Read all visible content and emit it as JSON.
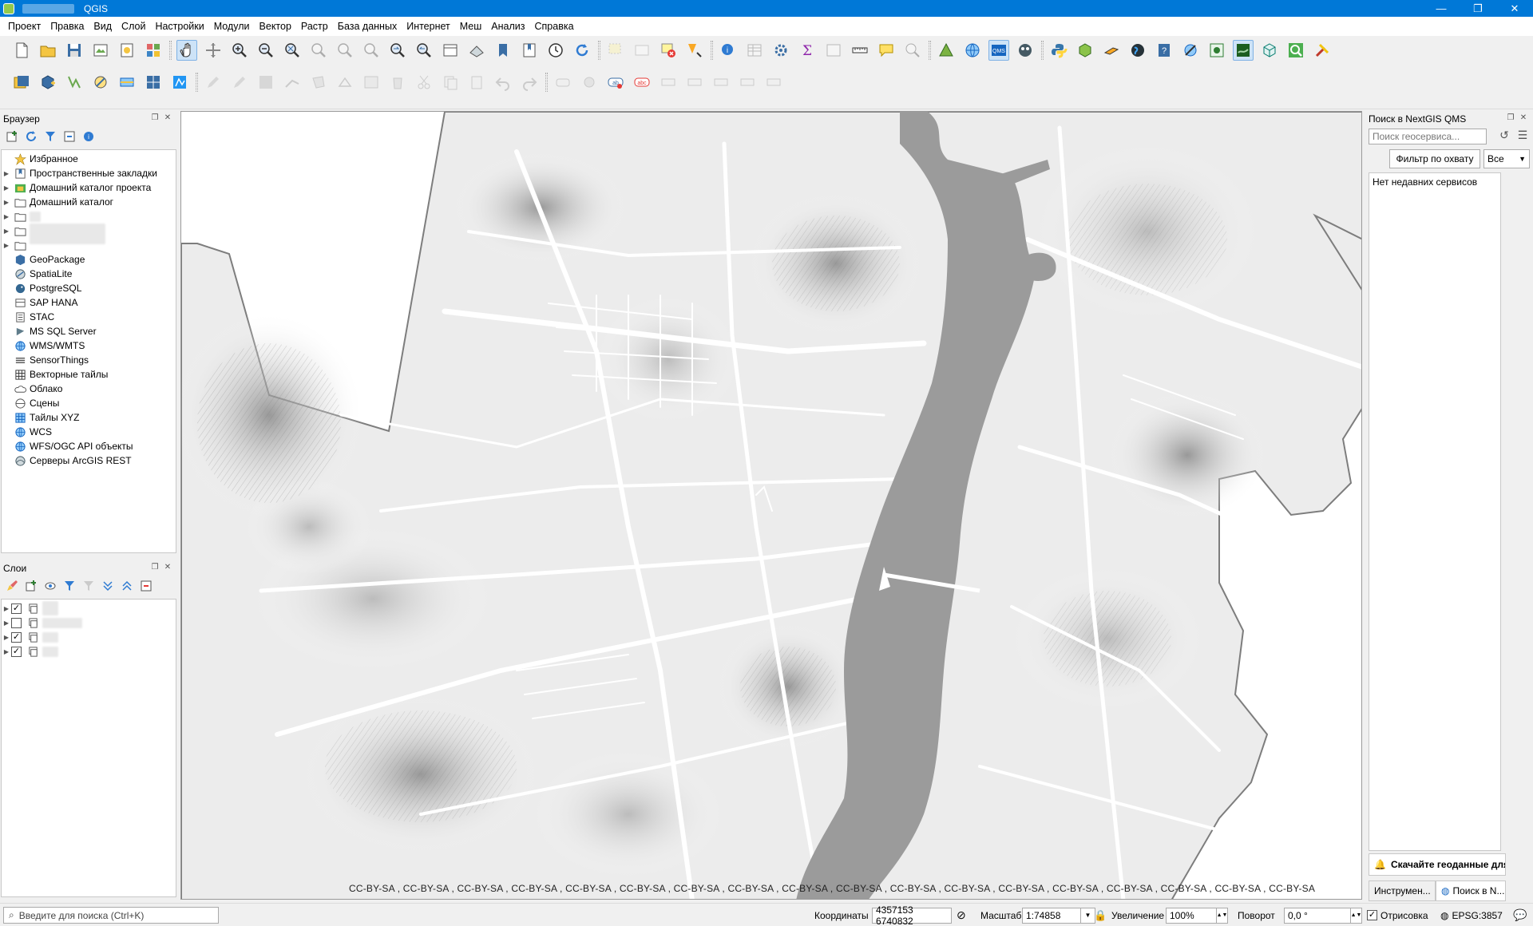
{
  "window": {
    "title": "QGIS",
    "controls": [
      "—",
      "❐",
      "✕"
    ]
  },
  "menu": [
    "Проект",
    "Правка",
    "Вид",
    "Слой",
    "Настройки",
    "Модули",
    "Вектор",
    "Растр",
    "База данных",
    "Интернет",
    "Меш",
    "Анализ",
    "Справка"
  ],
  "browser": {
    "title": "Браузер",
    "items": [
      {
        "label": "Избранное",
        "icon": "star-icon",
        "expand": false
      },
      {
        "label": "Пространственные закладки",
        "icon": "bookmark-icon",
        "expand": true
      },
      {
        "label": "Домашний каталог проекта",
        "icon": "project-home-icon",
        "expand": true
      },
      {
        "label": "Домашний каталог",
        "icon": "folder-icon",
        "expand": true
      },
      {
        "label": "",
        "icon": "folder-icon",
        "expand": true
      },
      {
        "label": "",
        "icon": "folder-icon",
        "expand": true
      },
      {
        "label": "",
        "icon": "folder-icon",
        "expand": true
      },
      {
        "label": "GeoPackage",
        "icon": "geopackage-icon",
        "expand": false
      },
      {
        "label": "SpatiaLite",
        "icon": "spatialite-icon",
        "expand": false
      },
      {
        "label": "PostgreSQL",
        "icon": "postgresql-icon",
        "expand": false
      },
      {
        "label": "SAP HANA",
        "icon": "sap-hana-icon",
        "expand": false
      },
      {
        "label": "STAC",
        "icon": "stac-icon",
        "expand": false
      },
      {
        "label": "MS SQL Server",
        "icon": "mssql-icon",
        "expand": false
      },
      {
        "label": "WMS/WMTS",
        "icon": "wms-icon",
        "expand": false
      },
      {
        "label": "SensorThings",
        "icon": "sensorthings-icon",
        "expand": false
      },
      {
        "label": "Векторные тайлы",
        "icon": "vector-tiles-icon",
        "expand": false
      },
      {
        "label": "Облако",
        "icon": "cloud-icon",
        "expand": false
      },
      {
        "label": "Сцены",
        "icon": "scenes-icon",
        "expand": false
      },
      {
        "label": "Тайлы XYZ",
        "icon": "xyz-tiles-icon",
        "expand": false
      },
      {
        "label": "WCS",
        "icon": "wcs-icon",
        "expand": false
      },
      {
        "label": "WFS/OGC API объекты",
        "icon": "wfs-icon",
        "expand": false
      },
      {
        "label": "Серверы ArcGIS REST",
        "icon": "arcgis-icon",
        "expand": false
      }
    ]
  },
  "layers": {
    "title": "Слои",
    "items": [
      {
        "checked": true
      },
      {
        "checked": false
      },
      {
        "checked": true
      },
      {
        "checked": true
      }
    ]
  },
  "qms": {
    "title": "Поиск в NextGIS QMS",
    "search_placeholder": "Поиск геосервиса...",
    "filter_button": "Фильтр по охвату",
    "filter_select": "Все",
    "empty_text": "Нет недавних сервисов",
    "banner": "Скачайте геоданные для прое",
    "tab_tools": "Инструмен...",
    "tab_qms": "Поиск в N..."
  },
  "map": {
    "attribution": "CC-BY-SA    , CC-BY-SA    , CC-BY-SA    , CC-BY-SA    , CC-BY-SA    , CC-BY-SA  , CC-BY-SA , CC-BY-SA , CC-BY-SA  , CC-BY-SA , CC-BY-SA , CC-BY-SA    , CC-BY-SA    , CC-BY-SA    , CC-BY-SA , CC-BY-SA    , CC-BY-SA , CC-BY-SA",
    "water_color": "#9b9b9b",
    "boundary_color": "#7d7d7d"
  },
  "status": {
    "search_placeholder": "Введите для поиска (Ctrl+K)",
    "coords_label": "Координаты",
    "coords_value": "4357153  6740832",
    "scale_label": "Масштаб",
    "scale_value": "1:74858",
    "magnifier_label": "Увеличение",
    "magnifier_value": "100%",
    "rotation_label": "Поворот",
    "rotation_value": "0,0 °",
    "render_label": "Отрисовка",
    "crs": "EPSG:3857"
  },
  "colors": {
    "titlebar": "#0078d7",
    "accent_green": "#93c94d"
  }
}
